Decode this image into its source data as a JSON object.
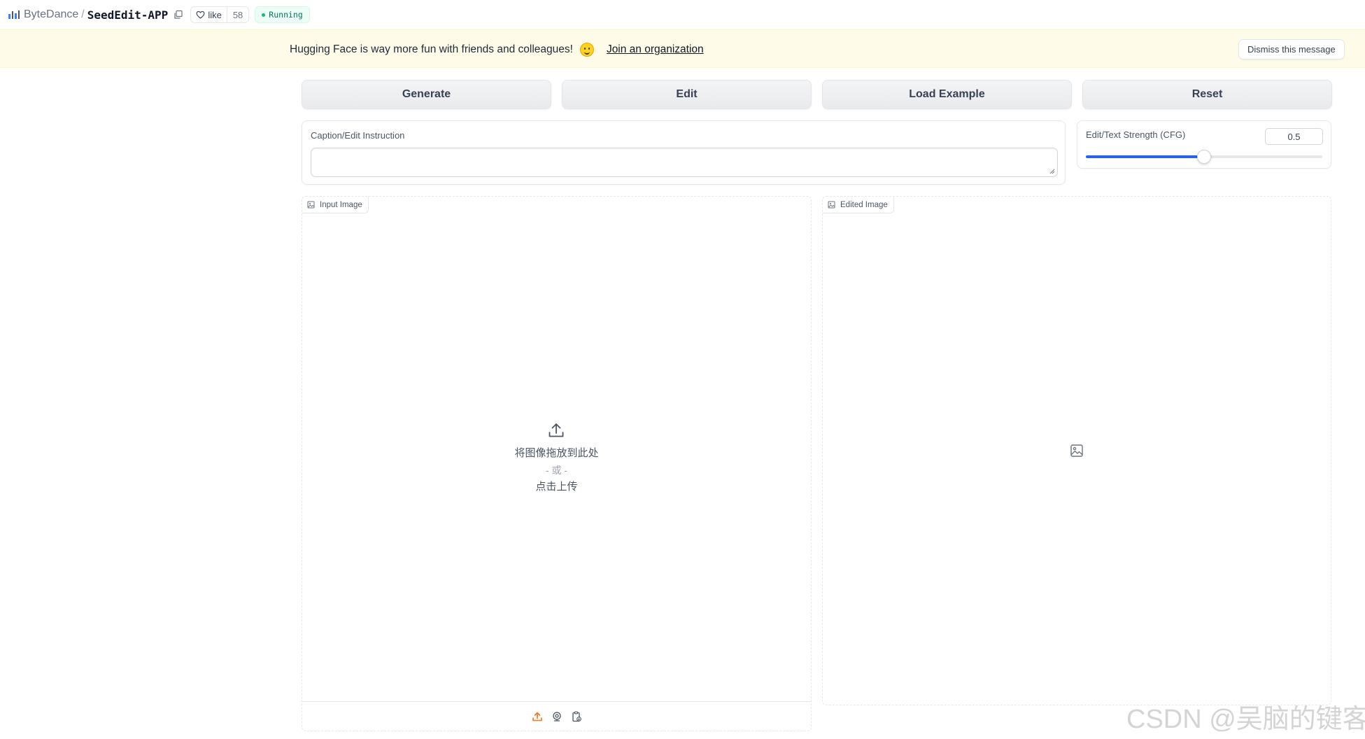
{
  "header": {
    "org": "ByteDance",
    "separator": "/",
    "repo": "SeedEdit-APP",
    "like_label": "like",
    "like_count": "58",
    "status": "Running"
  },
  "banner": {
    "text": "Hugging Face is way more fun with friends and colleagues!",
    "link": "Join an organization",
    "dismiss": "Dismiss this message"
  },
  "actions": {
    "generate": "Generate",
    "edit": "Edit",
    "load_example": "Load Example",
    "reset": "Reset"
  },
  "caption": {
    "label": "Caption/Edit Instruction",
    "value": ""
  },
  "cfg": {
    "label": "Edit/Text Strength (CFG)",
    "value": "0.5",
    "fraction": 0.5
  },
  "input_image": {
    "label": "Input Image",
    "drop_text": "将图像拖放到此处",
    "or_text": "- 或 -",
    "click_text": "点击上传"
  },
  "edited_image": {
    "label": "Edited Image"
  },
  "watermark": "CSDN @吴脑的键客",
  "colors": {
    "accent": "#2563eb",
    "running": "#10b981",
    "banner_bg": "#fefce8",
    "upload_icon_active": "#f97316"
  },
  "icons": {
    "space": "space-bars-icon",
    "copy": "copy-icon",
    "like": "heart-icon",
    "image": "image-icon",
    "upload": "upload-icon",
    "webcam": "webcam-icon",
    "clipboard": "clipboard-icon"
  }
}
